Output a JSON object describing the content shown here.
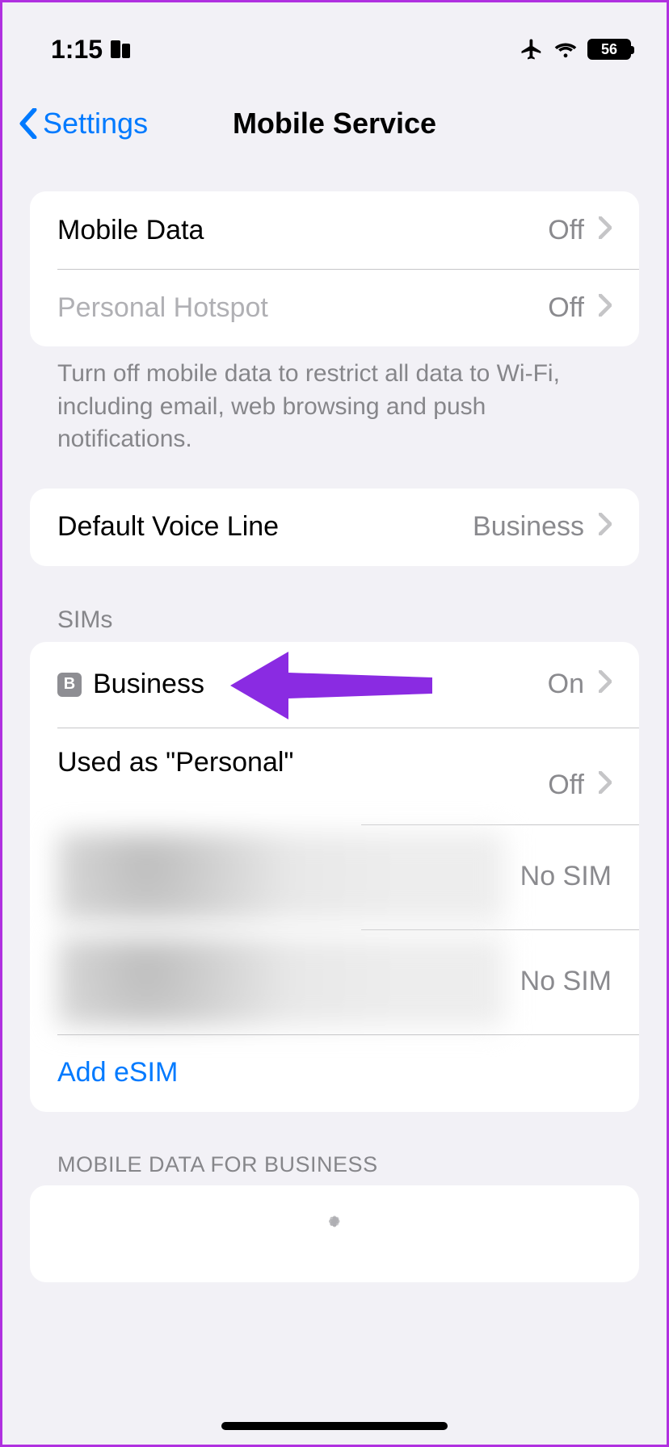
{
  "status_bar": {
    "time": "1:15",
    "battery_percent": "56"
  },
  "nav": {
    "back_label": "Settings",
    "title": "Mobile Service"
  },
  "data_group": {
    "mobile_data": {
      "label": "Mobile Data",
      "value": "Off"
    },
    "hotspot": {
      "label": "Personal Hotspot",
      "value": "Off"
    },
    "footer": "Turn off mobile data to restrict all data to Wi-Fi, including email, web browsing and push notifications."
  },
  "voice_line": {
    "label": "Default Voice Line",
    "value": "Business"
  },
  "sims": {
    "header": "SIMs",
    "business": {
      "badge": "B",
      "label": "Business",
      "value": "On"
    },
    "personal": {
      "label": "Used as \"Personal\"",
      "value": "Off"
    },
    "slot3": {
      "value": "No SIM"
    },
    "slot4": {
      "value": "No SIM"
    },
    "add_esim": "Add eSIM"
  },
  "data_for_business": {
    "header": "MOBILE DATA FOR BUSINESS"
  }
}
